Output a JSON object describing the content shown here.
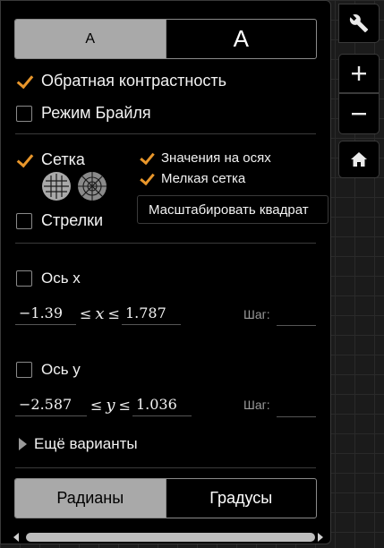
{
  "font_size": {
    "small_label": "A",
    "large_label": "A"
  },
  "options": {
    "reverse_contrast": {
      "label": "Обратная контрастность",
      "checked": true
    },
    "braille_mode": {
      "label": "Режим Брайля",
      "checked": false
    },
    "grid": {
      "label": "Сетка",
      "checked": true
    },
    "axis_numbers": {
      "label": "Значения на осях",
      "checked": true
    },
    "minor_grid": {
      "label": "Мелкая сетка",
      "checked": true
    },
    "arrows": {
      "label": "Стрелки",
      "checked": false
    },
    "scale_square_tooltip": "Масштабировать квадрат"
  },
  "x_axis": {
    "label": "Ось x",
    "checked": false,
    "min": "−1.39",
    "relation": "≤",
    "var": "x",
    "max": "1.787",
    "step_label": "Шаг:",
    "step_value": ""
  },
  "y_axis": {
    "label": "Ось y",
    "checked": false,
    "min": "−2.587",
    "relation": "≤",
    "var": "y",
    "max": "1.036",
    "step_label": "Шаг:",
    "step_value": ""
  },
  "more_options": "Ещё варианты",
  "angle_mode": {
    "radians": "Радианы",
    "degrees": "Градусы",
    "selected": "radians"
  },
  "colors": {
    "accent": "#e8962b",
    "active_segment": "#a9a9a9",
    "background": "#000000"
  },
  "icons": [
    "wrench-icon",
    "zoom-in-icon",
    "zoom-out-icon",
    "home-icon",
    "cartesian-grid-icon",
    "polar-grid-icon",
    "triangle-right-icon"
  ]
}
